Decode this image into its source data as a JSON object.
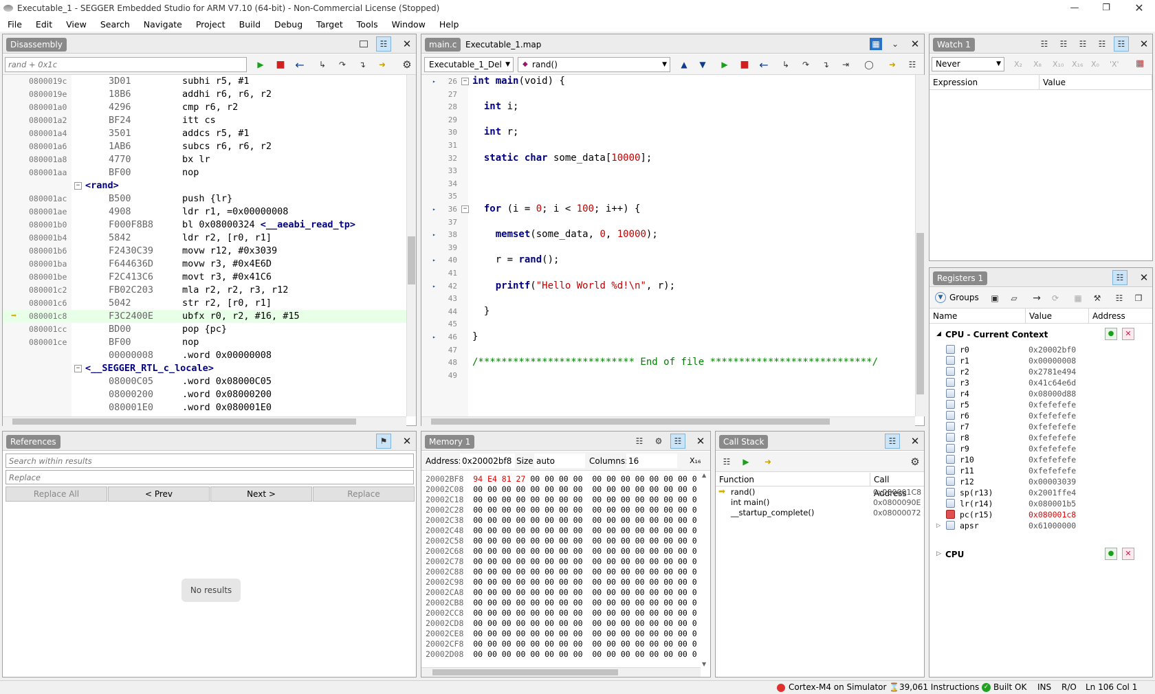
{
  "window": {
    "title": "Executable_1 - SEGGER Embedded Studio for ARM V7.10 (64-bit) - Non-Commercial License (Stopped)"
  },
  "menu": [
    "File",
    "Edit",
    "View",
    "Search",
    "Navigate",
    "Project",
    "Build",
    "Debug",
    "Target",
    "Tools",
    "Window",
    "Help"
  ],
  "disassembly": {
    "tab": "Disassembly",
    "location": "rand + 0x1c",
    "lines": [
      {
        "addr": "0800019c",
        "op": "3D01",
        "ins": "subhi r5, #1"
      },
      {
        "addr": "0800019e",
        "op": "18B6",
        "ins": "addhi r6, r6, r2"
      },
      {
        "addr": "080001a0",
        "op": "4296",
        "ins": "cmp r6, r2"
      },
      {
        "addr": "080001a2",
        "op": "BF24",
        "ins": "itt cs"
      },
      {
        "addr": "080001a4",
        "op": "3501",
        "ins": "addcs r5, #1"
      },
      {
        "addr": "080001a6",
        "op": "1AB6",
        "ins": "subcs r6, r6, r2"
      },
      {
        "addr": "080001a8",
        "op": "4770",
        "ins": "bx lr"
      },
      {
        "addr": "080001aa",
        "op": "BF00",
        "ins": "nop"
      },
      {
        "label": "<rand>"
      },
      {
        "addr": "080001ac",
        "op": "B500",
        "ins": "push {lr}"
      },
      {
        "addr": "080001ae",
        "op": "4908",
        "ins": "ldr r1, =0x00000008"
      },
      {
        "addr": "080001b0",
        "op": "F000F8B8",
        "ins": "bl 0x08000324 ",
        "sym": "<__aeabi_read_tp>"
      },
      {
        "addr": "080001b4",
        "op": "5842",
        "ins": "ldr r2, [r0, r1]"
      },
      {
        "addr": "080001b6",
        "op": "F2430C39",
        "ins": "movw r12, #0x3039"
      },
      {
        "addr": "080001ba",
        "op": "F644636D",
        "ins": "movw r3, #0x4E6D"
      },
      {
        "addr": "080001be",
        "op": "F2C413C6",
        "ins": "movt r3, #0x41C6"
      },
      {
        "addr": "080001c2",
        "op": "FB02C203",
        "ins": "mla r2, r2, r3, r12"
      },
      {
        "addr": "080001c6",
        "op": "5042",
        "ins": "str r2, [r0, r1]"
      },
      {
        "addr": "080001c8",
        "op": "F3C2400E",
        "ins": "ubfx r0, r2, #16, #15",
        "current": true
      },
      {
        "addr": "080001cc",
        "op": "BD00",
        "ins": "pop {pc}"
      },
      {
        "addr": "080001ce",
        "op": "BF00",
        "ins": "nop"
      },
      {
        "addr": "",
        "op": "00000008",
        "ins": ".word 0x00000008"
      },
      {
        "label": "<__SEGGER_RTL_c_locale>"
      },
      {
        "addr": "",
        "op": "08000C05",
        "ins": ".word 0x08000C05"
      },
      {
        "addr": "",
        "op": "08000200",
        "ins": ".word 0x08000200"
      },
      {
        "addr": "",
        "op": "080001E0",
        "ins": ".word 0x080001E0"
      }
    ]
  },
  "editor": {
    "tabs": [
      "main.c",
      "Executable_1.map"
    ],
    "project_combo": "Executable_1_Del",
    "function_combo": "rand()",
    "lines": [
      {
        "n": "26",
        "bp": true,
        "fold": true,
        "segs": [
          [
            "kw",
            "int "
          ],
          [
            "kw",
            "main"
          ],
          [
            "p",
            "(void) {"
          ]
        ]
      },
      {
        "n": "27",
        "segs": []
      },
      {
        "n": "28",
        "segs": [
          [
            "p",
            "  "
          ],
          [
            "kw",
            "int"
          ],
          [
            "p",
            " i;"
          ]
        ]
      },
      {
        "n": "29",
        "segs": []
      },
      {
        "n": "30",
        "segs": [
          [
            "p",
            "  "
          ],
          [
            "kw",
            "int"
          ],
          [
            "p",
            " r;"
          ]
        ]
      },
      {
        "n": "31",
        "segs": []
      },
      {
        "n": "32",
        "segs": [
          [
            "p",
            "  "
          ],
          [
            "kw",
            "static char"
          ],
          [
            "p",
            " some_data["
          ],
          [
            "num",
            "10000"
          ],
          [
            "p",
            "];"
          ]
        ]
      },
      {
        "n": "33",
        "segs": []
      },
      {
        "n": "34",
        "segs": []
      },
      {
        "n": "35",
        "segs": []
      },
      {
        "n": "36",
        "bp": true,
        "fold": true,
        "segs": [
          [
            "p",
            "  "
          ],
          [
            "kw",
            "for"
          ],
          [
            "p",
            " (i = "
          ],
          [
            "num",
            "0"
          ],
          [
            "p",
            "; i < "
          ],
          [
            "num",
            "100"
          ],
          [
            "p",
            "; i++) {"
          ]
        ]
      },
      {
        "n": "37",
        "segs": []
      },
      {
        "n": "38",
        "bp": true,
        "segs": [
          [
            "p",
            "    "
          ],
          [
            "kw",
            "memset"
          ],
          [
            "p",
            "(some_data, "
          ],
          [
            "num",
            "0"
          ],
          [
            "p",
            ", "
          ],
          [
            "num",
            "10000"
          ],
          [
            "p",
            ");"
          ]
        ]
      },
      {
        "n": "39",
        "segs": []
      },
      {
        "n": "40",
        "bp": true,
        "segs": [
          [
            "p",
            "    r = "
          ],
          [
            "kw",
            "rand"
          ],
          [
            "p",
            "();"
          ]
        ]
      },
      {
        "n": "41",
        "segs": []
      },
      {
        "n": "42",
        "bp": true,
        "segs": [
          [
            "p",
            "    "
          ],
          [
            "kw",
            "printf"
          ],
          [
            "p",
            "("
          ],
          [
            "str",
            "\"Hello World %d!\\n\""
          ],
          [
            "p",
            ", r);"
          ]
        ]
      },
      {
        "n": "43",
        "segs": []
      },
      {
        "n": "44",
        "segs": [
          [
            "p",
            "  }"
          ]
        ]
      },
      {
        "n": "45",
        "segs": []
      },
      {
        "n": "46",
        "bp": true,
        "segs": [
          [
            "p",
            "}"
          ]
        ]
      },
      {
        "n": "47",
        "segs": []
      },
      {
        "n": "48",
        "segs": [
          [
            "cm",
            "/*************************** End of file ****************************/"
          ]
        ]
      },
      {
        "n": "49",
        "segs": []
      }
    ]
  },
  "watch": {
    "tab": "Watch 1",
    "update_mode": "Never",
    "columns": [
      "Expression",
      "Value"
    ]
  },
  "registers": {
    "tab": "Registers 1",
    "groups_label": "Groups",
    "columns": [
      "Name",
      "Value",
      "Address"
    ],
    "group_title": "CPU - Current Context",
    "rows": [
      {
        "name": "r0",
        "value": "0x20002bf0"
      },
      {
        "name": "r1",
        "value": "0x00000008"
      },
      {
        "name": "r2",
        "value": "0x2781e494"
      },
      {
        "name": "r3",
        "value": "0x41c64e6d"
      },
      {
        "name": "r4",
        "value": "0x08000d88"
      },
      {
        "name": "r5",
        "value": "0xfefefefe"
      },
      {
        "name": "r6",
        "value": "0xfefefefe"
      },
      {
        "name": "r7",
        "value": "0xfefefefe"
      },
      {
        "name": "r8",
        "value": "0xfefefefe"
      },
      {
        "name": "r9",
        "value": "0xfefefefe"
      },
      {
        "name": "r10",
        "value": "0xfefefefe"
      },
      {
        "name": "r11",
        "value": "0xfefefefe"
      },
      {
        "name": "r12",
        "value": "0x00003039"
      },
      {
        "name": "sp(r13)",
        "value": "0x2001ffe4"
      },
      {
        "name": "lr(r14)",
        "value": "0x080001b5"
      },
      {
        "name": "pc(r15)",
        "value": "0x080001c8",
        "changed": true
      },
      {
        "name": "apsr",
        "value": "0x61000000",
        "expandable": true
      }
    ],
    "group2_title": "CPU"
  },
  "references": {
    "tab": "References",
    "search_placeholder": "Search within results",
    "replace_placeholder": "Replace",
    "buttons": [
      "Replace All",
      "< Prev",
      "Next >",
      "Replace"
    ],
    "empty_text": "No results"
  },
  "memory": {
    "tab": "Memory 1",
    "address_label": "Address:",
    "address_value": "0x20002bf8",
    "size_label": "Size:",
    "size_value": "auto",
    "columns_label": "Columns:",
    "columns_value": "16",
    "rows": [
      {
        "addr": "20002BF8",
        "changed": "94 E4 81 27",
        "rest": " 00 00 00 00  00 00 00 00 00 00 00 0"
      },
      {
        "addr": "20002C08",
        "bytes": "00 00 00 00 00 00 00 00  00 00 00 00 00 00 00 0"
      },
      {
        "addr": "20002C18",
        "bytes": "00 00 00 00 00 00 00 00  00 00 00 00 00 00 00 0"
      },
      {
        "addr": "20002C28",
        "bytes": "00 00 00 00 00 00 00 00  00 00 00 00 00 00 00 0"
      },
      {
        "addr": "20002C38",
        "bytes": "00 00 00 00 00 00 00 00  00 00 00 00 00 00 00 0"
      },
      {
        "addr": "20002C48",
        "bytes": "00 00 00 00 00 00 00 00  00 00 00 00 00 00 00 0"
      },
      {
        "addr": "20002C58",
        "bytes": "00 00 00 00 00 00 00 00  00 00 00 00 00 00 00 0"
      },
      {
        "addr": "20002C68",
        "bytes": "00 00 00 00 00 00 00 00  00 00 00 00 00 00 00 0"
      },
      {
        "addr": "20002C78",
        "bytes": "00 00 00 00 00 00 00 00  00 00 00 00 00 00 00 0"
      },
      {
        "addr": "20002C88",
        "bytes": "00 00 00 00 00 00 00 00  00 00 00 00 00 00 00 0"
      },
      {
        "addr": "20002C98",
        "bytes": "00 00 00 00 00 00 00 00  00 00 00 00 00 00 00 0"
      },
      {
        "addr": "20002CA8",
        "bytes": "00 00 00 00 00 00 00 00  00 00 00 00 00 00 00 0"
      },
      {
        "addr": "20002CB8",
        "bytes": "00 00 00 00 00 00 00 00  00 00 00 00 00 00 00 0"
      },
      {
        "addr": "20002CC8",
        "bytes": "00 00 00 00 00 00 00 00  00 00 00 00 00 00 00 0"
      },
      {
        "addr": "20002CD8",
        "bytes": "00 00 00 00 00 00 00 00  00 00 00 00 00 00 00 0"
      },
      {
        "addr": "20002CE8",
        "bytes": "00 00 00 00 00 00 00 00  00 00 00 00 00 00 00 0"
      },
      {
        "addr": "20002CF8",
        "bytes": "00 00 00 00 00 00 00 00  00 00 00 00 00 00 00 0"
      },
      {
        "addr": "20002D08",
        "bytes": "00 00 00 00 00 00 00 00  00 00 00 00 00 00 00 0"
      }
    ]
  },
  "callstack": {
    "tab": "Call Stack",
    "columns": [
      "Function",
      "Call Address"
    ],
    "rows": [
      {
        "fn": "rand()",
        "addr": "0x080001C8",
        "current": true
      },
      {
        "fn": "int main()",
        "addr": "0x0800090E"
      },
      {
        "fn": "__startup_complete()",
        "addr": "0x08000072"
      }
    ]
  },
  "status": {
    "target": "Cortex-M4 on Simulator",
    "instructions": "39,061 Instructions",
    "build": "Built OK",
    "ins": "INS",
    "ro": "R/O",
    "position": "Ln 106 Col 1"
  },
  "colors": {
    "accent": "#0078d7",
    "current_line": "#e8ffe8",
    "changed": "#e00000",
    "keyword": "#000080",
    "comment": "#008000",
    "number": "#c00000"
  }
}
